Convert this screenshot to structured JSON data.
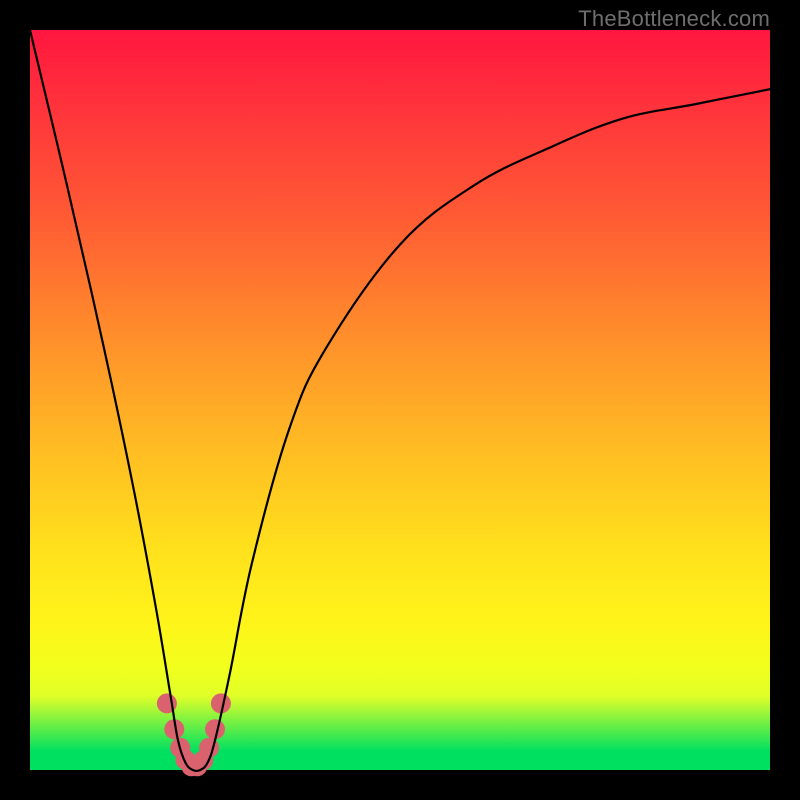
{
  "watermark": "TheBottleneck.com",
  "chart_data": {
    "type": "line",
    "title": "",
    "xlabel": "",
    "ylabel": "",
    "xlim": [
      0,
      100
    ],
    "ylim": [
      0,
      100
    ],
    "series": [
      {
        "name": "curve",
        "x": [
          0,
          5,
          10,
          14,
          17,
          19,
          20,
          21,
          22,
          23,
          24,
          25,
          27,
          30,
          35,
          40,
          50,
          60,
          70,
          80,
          90,
          100
        ],
        "values": [
          100,
          79,
          57,
          38,
          22,
          10,
          4,
          1,
          0,
          0,
          1,
          4,
          13,
          28,
          46,
          57,
          71,
          79,
          84,
          88,
          90,
          92
        ]
      }
    ],
    "markers": {
      "name": "highlight-dots",
      "color": "#d9626e",
      "radius_px": 10,
      "x": [
        18.5,
        19.5,
        20.3,
        21.0,
        21.8,
        22.6,
        23.4,
        24.2,
        25.0,
        25.8
      ],
      "values": [
        9.0,
        5.5,
        3.0,
        1.4,
        0.5,
        0.5,
        1.3,
        3.0,
        5.5,
        9.0
      ]
    }
  }
}
